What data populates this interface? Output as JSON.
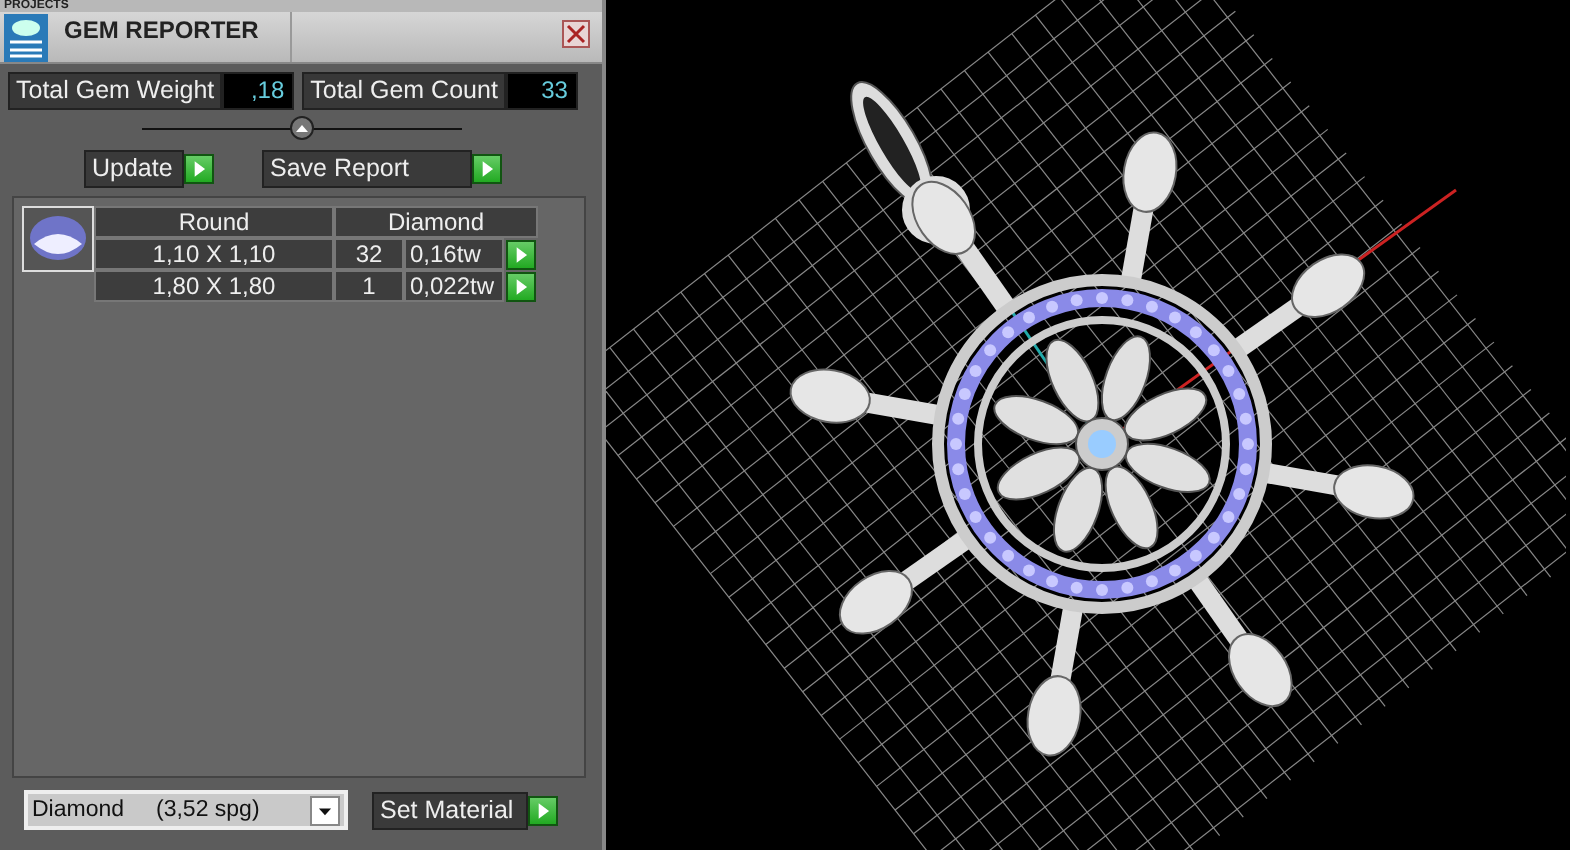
{
  "panel": {
    "header": "PROJECTS",
    "title": "GEM REPORTER"
  },
  "stats": [
    {
      "label": "Total Gem Weight",
      "value": ",18"
    },
    {
      "label": "Total Gem Count",
      "value": "33"
    }
  ],
  "actions": [
    {
      "label": "Update"
    },
    {
      "label": "Save Report"
    }
  ],
  "gems": {
    "shape": "Round",
    "material": "Diamond",
    "rows": [
      {
        "size": "1,10 X 1,10",
        "count": "32",
        "weight": "0,16tw"
      },
      {
        "size": "1,80 X 1,80",
        "count": "1",
        "weight": "0,022tw"
      }
    ]
  },
  "material_select": {
    "value": "Diamond     (3,52 spg)"
  },
  "set_button": {
    "label": "Set Material"
  }
}
